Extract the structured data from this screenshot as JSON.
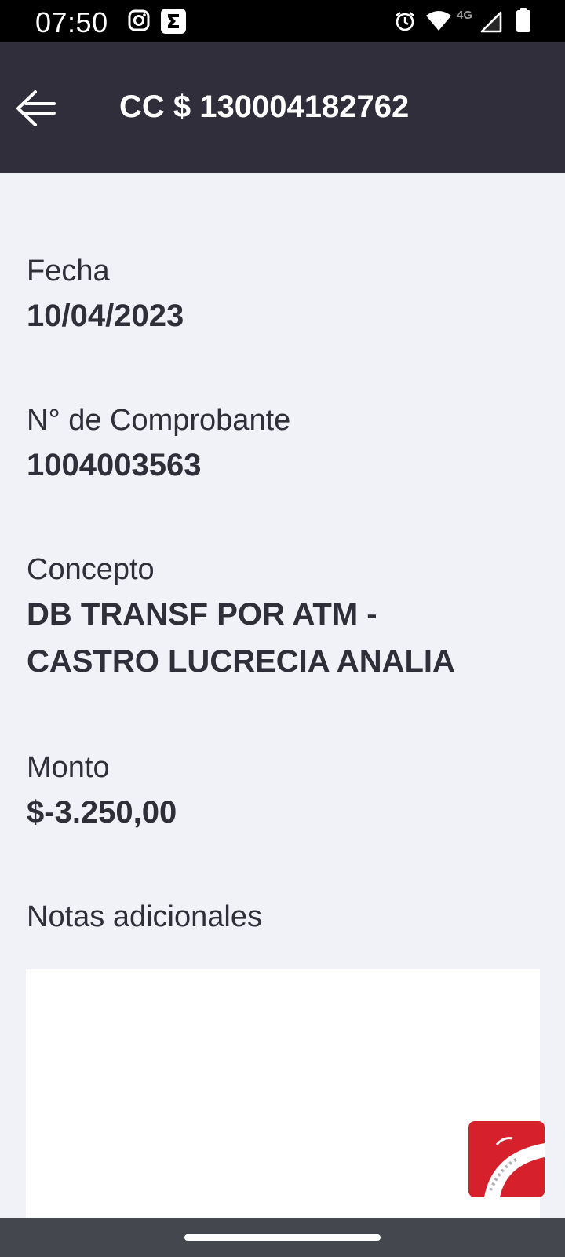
{
  "status_bar": {
    "time": "07:50",
    "icons": [
      "instagram-icon",
      "sigma-app-icon",
      "alarm-icon",
      "wifi-icon",
      "cell-signal-icon",
      "battery-icon"
    ],
    "network": "4G"
  },
  "header": {
    "back_icon": "arrow-back-icon",
    "title": "CC $ 130004182762"
  },
  "details": {
    "date_label": "Fecha",
    "date_value": "10/04/2023",
    "receipt_label": "N° de Comprobante",
    "receipt_value": "1004003563",
    "concept_label": "Concepto",
    "concept_line1": "DB TRANSF POR ATM -",
    "concept_line2": "CASTRO LUCRECIA ANALIA",
    "amount_label": "Monto",
    "amount_value": "$-3.250,00",
    "notes_label": "Notas adicionales",
    "notes_value": ""
  },
  "colors": {
    "header_bg": "#2f2e3a",
    "page_bg": "#f1f2f7",
    "text": "#2f2f3a",
    "logo_red": "#d6202b"
  }
}
